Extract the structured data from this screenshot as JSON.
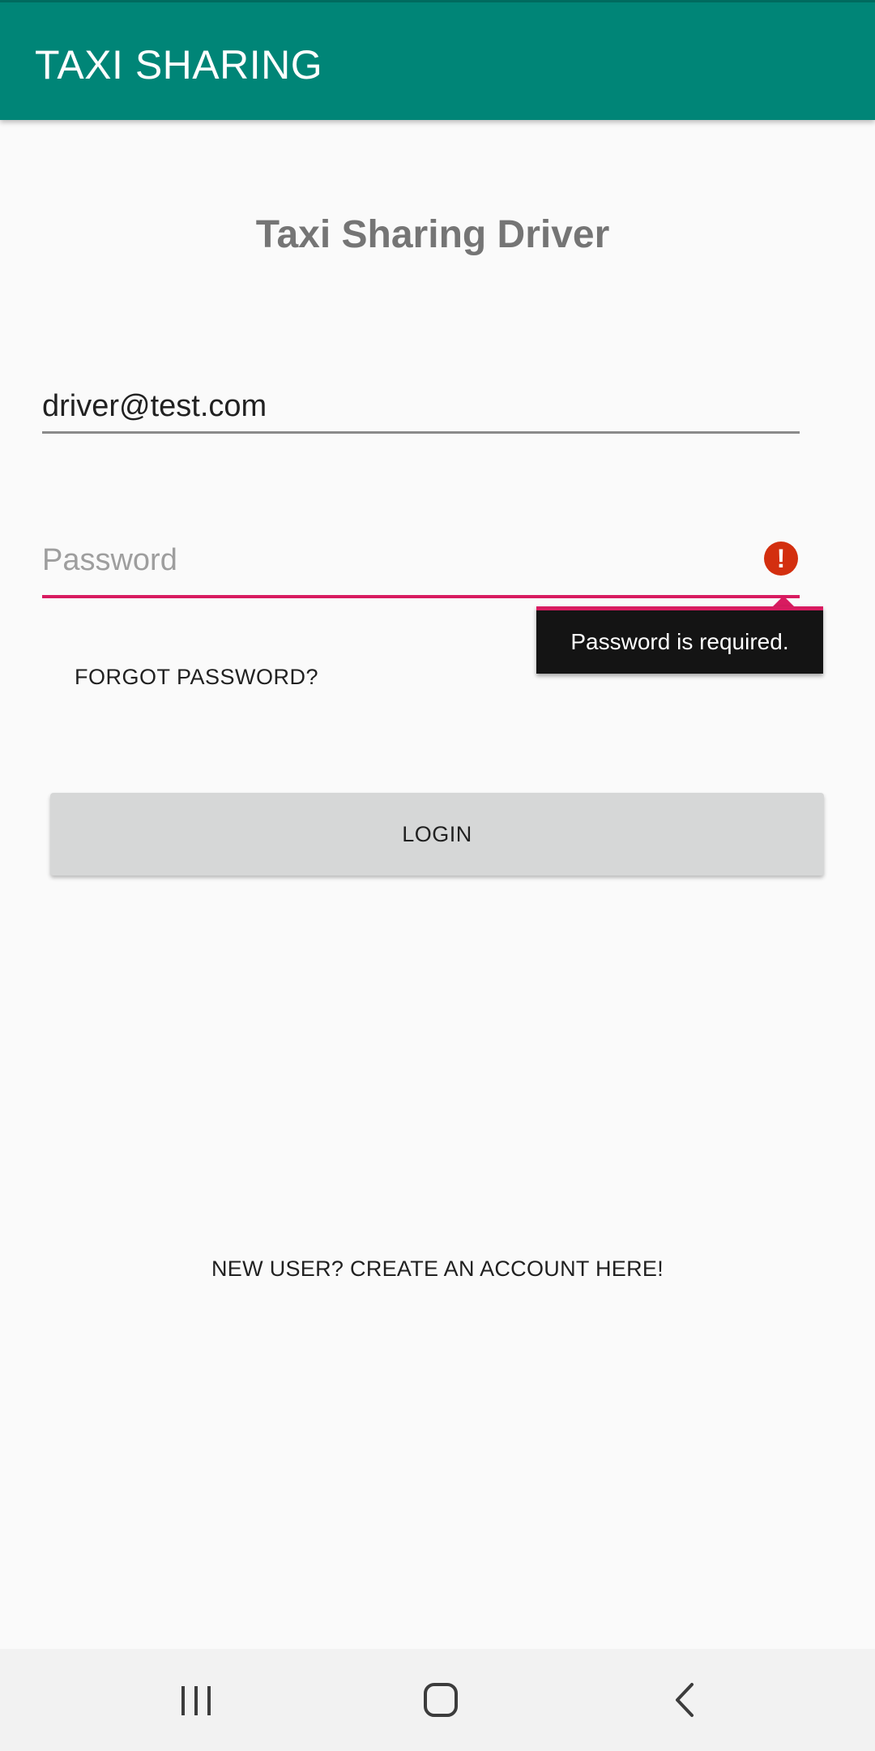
{
  "app_bar": {
    "title": "TAXI SHARING",
    "color": "#008577"
  },
  "heading": "Taxi Sharing Driver",
  "email_field": {
    "value": "driver@test.com"
  },
  "password_field": {
    "placeholder": "Password",
    "error_icon": "error-icon",
    "error_message": "Password is required.",
    "error_color": "#d81b60"
  },
  "forgot_password": "FORGOT PASSWORD?",
  "login_button": "LOGIN",
  "signup_link": "NEW USER? CREATE AN ACCOUNT HERE!",
  "nav_bar": {
    "recents_icon": "recents-icon",
    "home_icon": "home-icon",
    "back_icon": "back-icon"
  }
}
